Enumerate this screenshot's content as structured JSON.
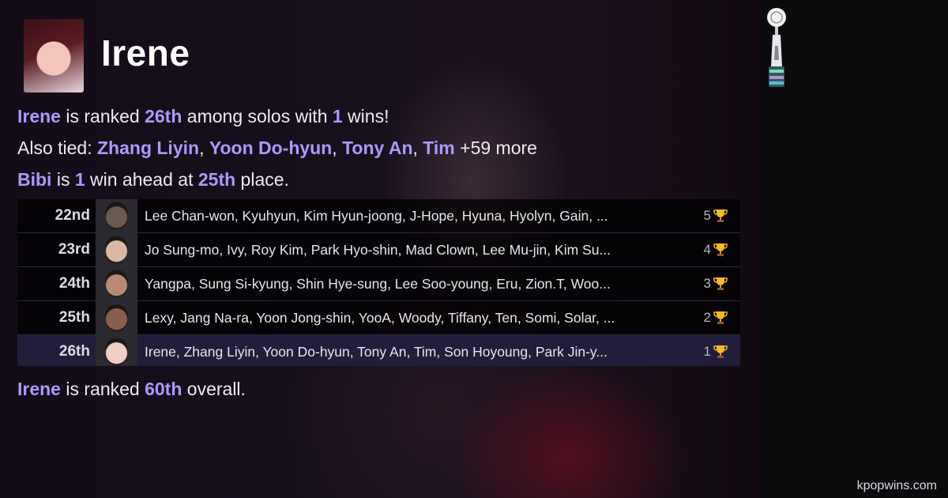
{
  "artist": {
    "name": "Irene"
  },
  "summary": {
    "line1": {
      "name": "Irene",
      "t1": " is ranked ",
      "rank": "26th",
      "t2": " among solos with ",
      "wins": "1",
      "t3": " wins!"
    },
    "line2": {
      "prefix": "Also tied: ",
      "tied": [
        "Zhang Liyin",
        "Yoon Do-hyun",
        "Tony An",
        "Tim"
      ],
      "sep": ", ",
      "more": " +59 more"
    },
    "line3": {
      "name": "Bibi",
      "t1": " is ",
      "wins": "1",
      "t2": " win ahead at ",
      "rank": "25th",
      "t3": " place."
    },
    "line4": {
      "name": "Irene",
      "t1": " is ranked ",
      "rank": "60th",
      "t2": " overall."
    }
  },
  "rankings": [
    {
      "rank": "22nd",
      "names": "Lee Chan-won, Kyuhyun, Kim Hyun-joong, J-Hope, Hyuna, Hyolyn, Gain, ...",
      "wins": "5",
      "face_color": "#6b5a52"
    },
    {
      "rank": "23rd",
      "names": "Jo Sung-mo, Ivy, Roy Kim, Park Hyo-shin, Mad Clown, Lee Mu-jin, Kim Su...",
      "wins": "4",
      "face_color": "#d9b9a6"
    },
    {
      "rank": "24th",
      "names": "Yangpa, Sung Si-kyung, Shin Hye-sung, Lee Soo-young, Eru, Zion.T, Woo...",
      "wins": "3",
      "face_color": "#b88a74"
    },
    {
      "rank": "25th",
      "names": "Lexy, Jang Na-ra, Yoon Jong-shin, YooA, Woody, Tiffany, Ten, Somi, Solar, ...",
      "wins": "2",
      "face_color": "#8a5e4c"
    },
    {
      "rank": "26th",
      "names": "Irene, Zhang Liyin, Yoon Do-hyun, Tony An, Tim, Son Hoyoung, Park Jin-y...",
      "wins": "1",
      "face_color": "#efcfc6",
      "highlighted": true
    }
  ],
  "footer": {
    "site": "kpopwins.com"
  },
  "colors": {
    "accent": "#a89bff",
    "highlight_row": "#221d3a",
    "trophy": "#f5b82e"
  }
}
